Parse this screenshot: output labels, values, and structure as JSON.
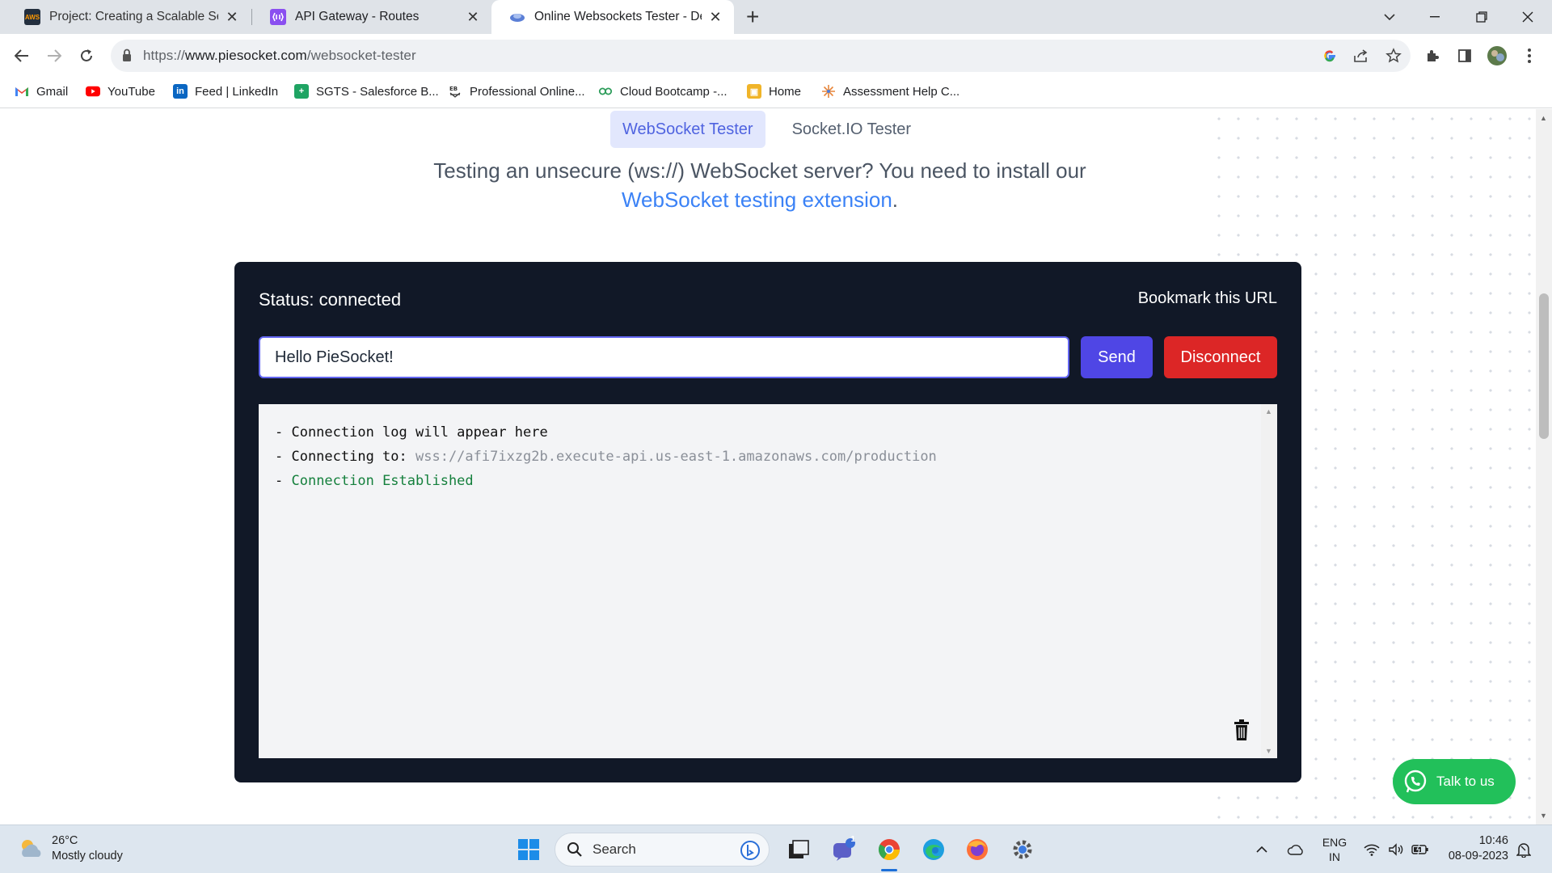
{
  "browser": {
    "tabs": [
      {
        "title": "Project: Creating a Scalable Serve",
        "favicon_text": "AWS",
        "favicon_color": "#232f3e",
        "active": false
      },
      {
        "title": "API Gateway - Routes",
        "favicon_text": "",
        "favicon_color": "#8a4ff0",
        "active": false
      },
      {
        "title": "Online Websockets Tester - Debu",
        "favicon_text": "",
        "favicon_color": "#5b7fd6",
        "active": true
      }
    ],
    "new_tab_label": "+",
    "url": {
      "scheme": "https://",
      "host": "www.piesocket.com",
      "path": "/websocket-tester"
    },
    "bookmarks": [
      {
        "label": "Gmail",
        "icon": "gmail-icon"
      },
      {
        "label": "YouTube",
        "icon": "youtube-icon"
      },
      {
        "label": "Feed | LinkedIn",
        "icon": "linkedin-icon"
      },
      {
        "label": "SGTS - Salesforce B...",
        "icon": "salesforce-icon"
      },
      {
        "label": "Professional Online...",
        "icon": "document-icon"
      },
      {
        "label": "Cloud Bootcamp -...",
        "icon": "cloud-bootcamp-icon"
      },
      {
        "label": "Home",
        "icon": "home-box-icon"
      },
      {
        "label": "Assessment Help C...",
        "icon": "sparkle-icon"
      }
    ]
  },
  "page": {
    "tabs": [
      "WebSocket Tester",
      "Socket.IO Tester"
    ],
    "active_tab": 0,
    "notice_text": "Testing an unsecure (ws://) WebSocket server? You need to install our ",
    "notice_link": "WebSocket testing extension",
    "notice_end": ".",
    "status": "Status: connected",
    "bookmark_link": "Bookmark this URL",
    "message_value": "Hello PieSocket!",
    "send_label": "Send",
    "disconnect_label": "Disconnect",
    "log": [
      {
        "prefix": "- Connection log will appear here",
        "value": ""
      },
      {
        "prefix": "- Connecting to: ",
        "value": "wss://afi7ixzg2b.execute-api.us-east-1.amazonaws.com/production"
      },
      {
        "prefix": "- ",
        "value": "Connection Established"
      }
    ],
    "talk_label": "Talk to us"
  },
  "taskbar": {
    "weather_temp": "26°C",
    "weather_desc": "Mostly cloudy",
    "search_label": "Search",
    "teams_badge": "1",
    "lang": "ENG",
    "region": "IN",
    "time": "10:46",
    "date": "08-09-2023"
  },
  "colors": {
    "panel_bg": "#111827",
    "send_btn": "#4f46e5",
    "disconnect_btn": "#dc2626",
    "link": "#3b82f6",
    "log_success": "#15803d",
    "talk_btn": "#22c05a"
  }
}
